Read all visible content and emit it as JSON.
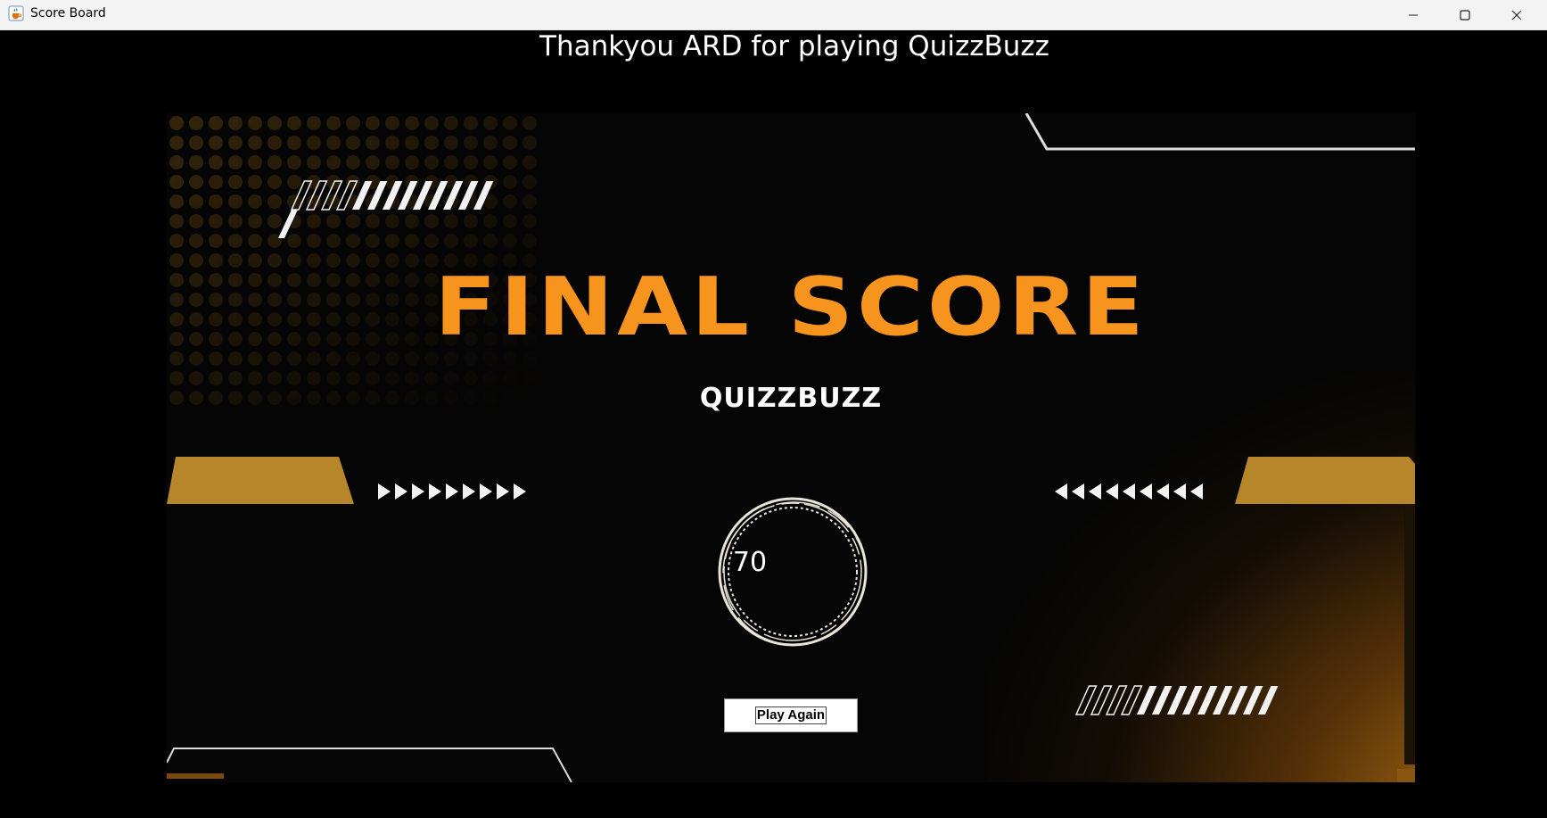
{
  "window": {
    "title": "Score Board",
    "app_icon": "java-cup-icon",
    "controls": [
      "minimize-icon",
      "maximize-icon",
      "close-icon"
    ]
  },
  "header": {
    "thank_you": "Thankyou ARD for playing QuizzBuzz"
  },
  "banner": {
    "headline": "FINAL SCORE",
    "brand": "QUIZZBUZZ",
    "accent_color": "#f7941d",
    "bar_color": "#b8862a"
  },
  "score": {
    "value": "70"
  },
  "actions": {
    "play_again_label": "Play Again"
  }
}
